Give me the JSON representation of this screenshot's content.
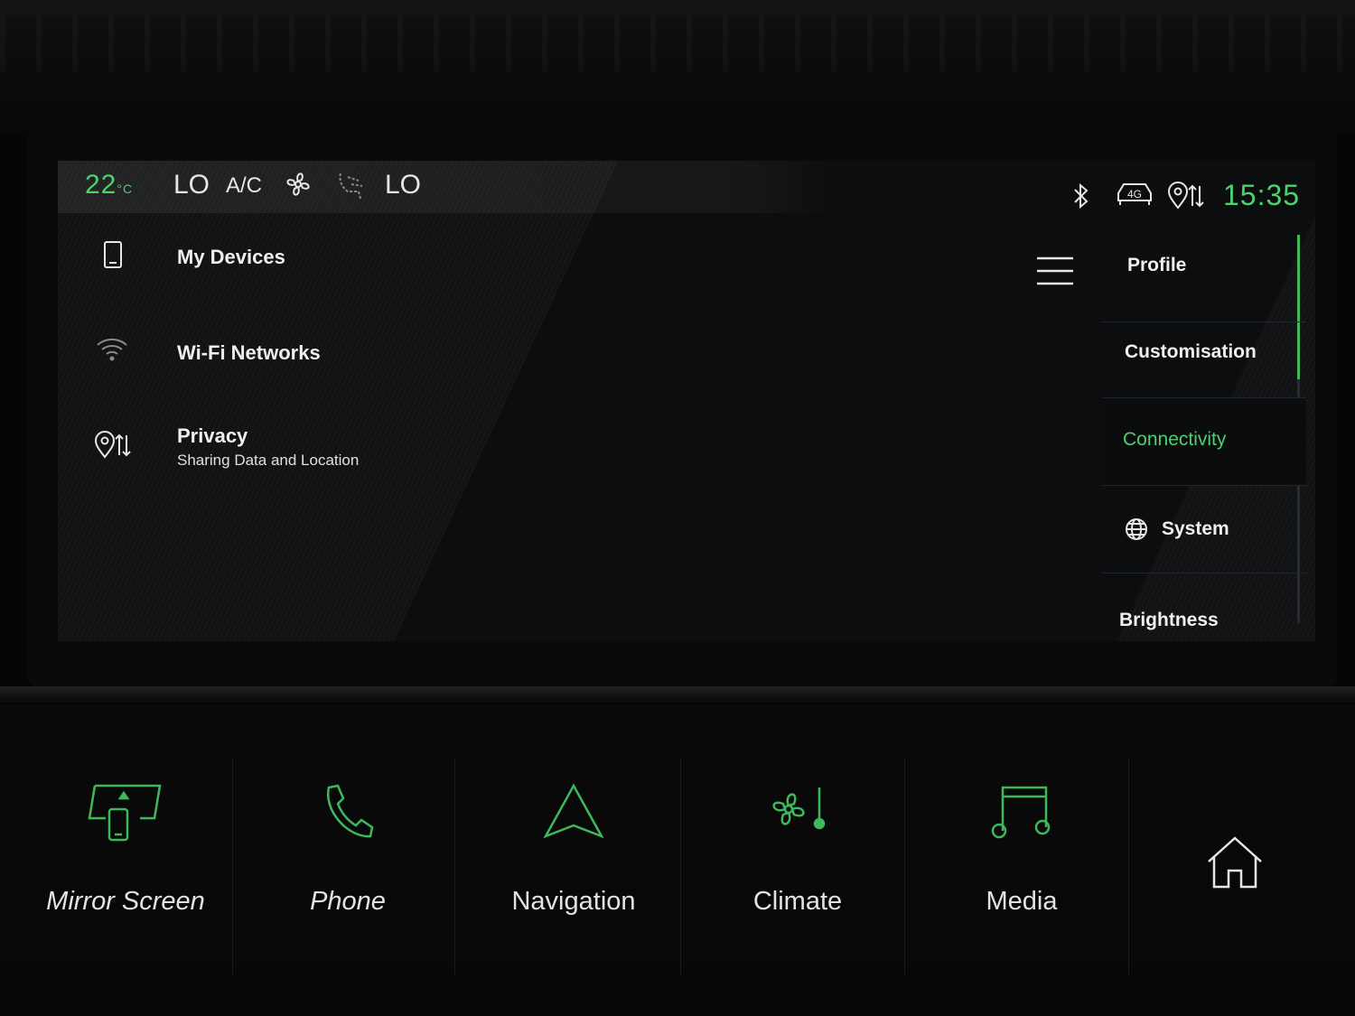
{
  "status_bar": {
    "temperature": "22",
    "temperature_unit": "°C",
    "fan_left": "LO",
    "ac_label": "A/C",
    "fan_right": "LO",
    "clock": "15:35",
    "network_badge": "4G",
    "icons": [
      "fan-icon",
      "seat-airflow-icon",
      "bluetooth-icon",
      "car-network-icon",
      "location-sharing-icon"
    ]
  },
  "settings": {
    "rows": [
      {
        "label": "My Devices",
        "icon": "phone-icon"
      },
      {
        "label": "Wi-Fi Networks",
        "icon": "wifi-icon"
      },
      {
        "label": "Privacy",
        "sub": "Sharing Data and Location",
        "icon": "location-sharing-icon"
      }
    ],
    "menu_icon": "hamburger-menu-icon"
  },
  "tabs": [
    {
      "label": "Profile",
      "active": false
    },
    {
      "label": "Customisation",
      "active": false
    },
    {
      "label": "Connectivity",
      "active": true
    },
    {
      "label": "System",
      "active": false,
      "icon": "globe-icon"
    },
    {
      "label": "Brightness",
      "active": false
    }
  ],
  "keys": [
    {
      "label": "Mirror Screen",
      "icon": "mirror-screen-icon"
    },
    {
      "label": "Phone",
      "icon": "phone-handset-icon"
    },
    {
      "label": "Navigation",
      "icon": "navigation-arrow-icon"
    },
    {
      "label": "Climate",
      "icon": "climate-icon"
    },
    {
      "label": "Media",
      "icon": "music-note-icon"
    },
    {
      "label": "",
      "icon": "home-icon"
    }
  ],
  "colors": {
    "accent": "#4fcf6e",
    "background": "#111214",
    "text": "#f0f0f0"
  }
}
